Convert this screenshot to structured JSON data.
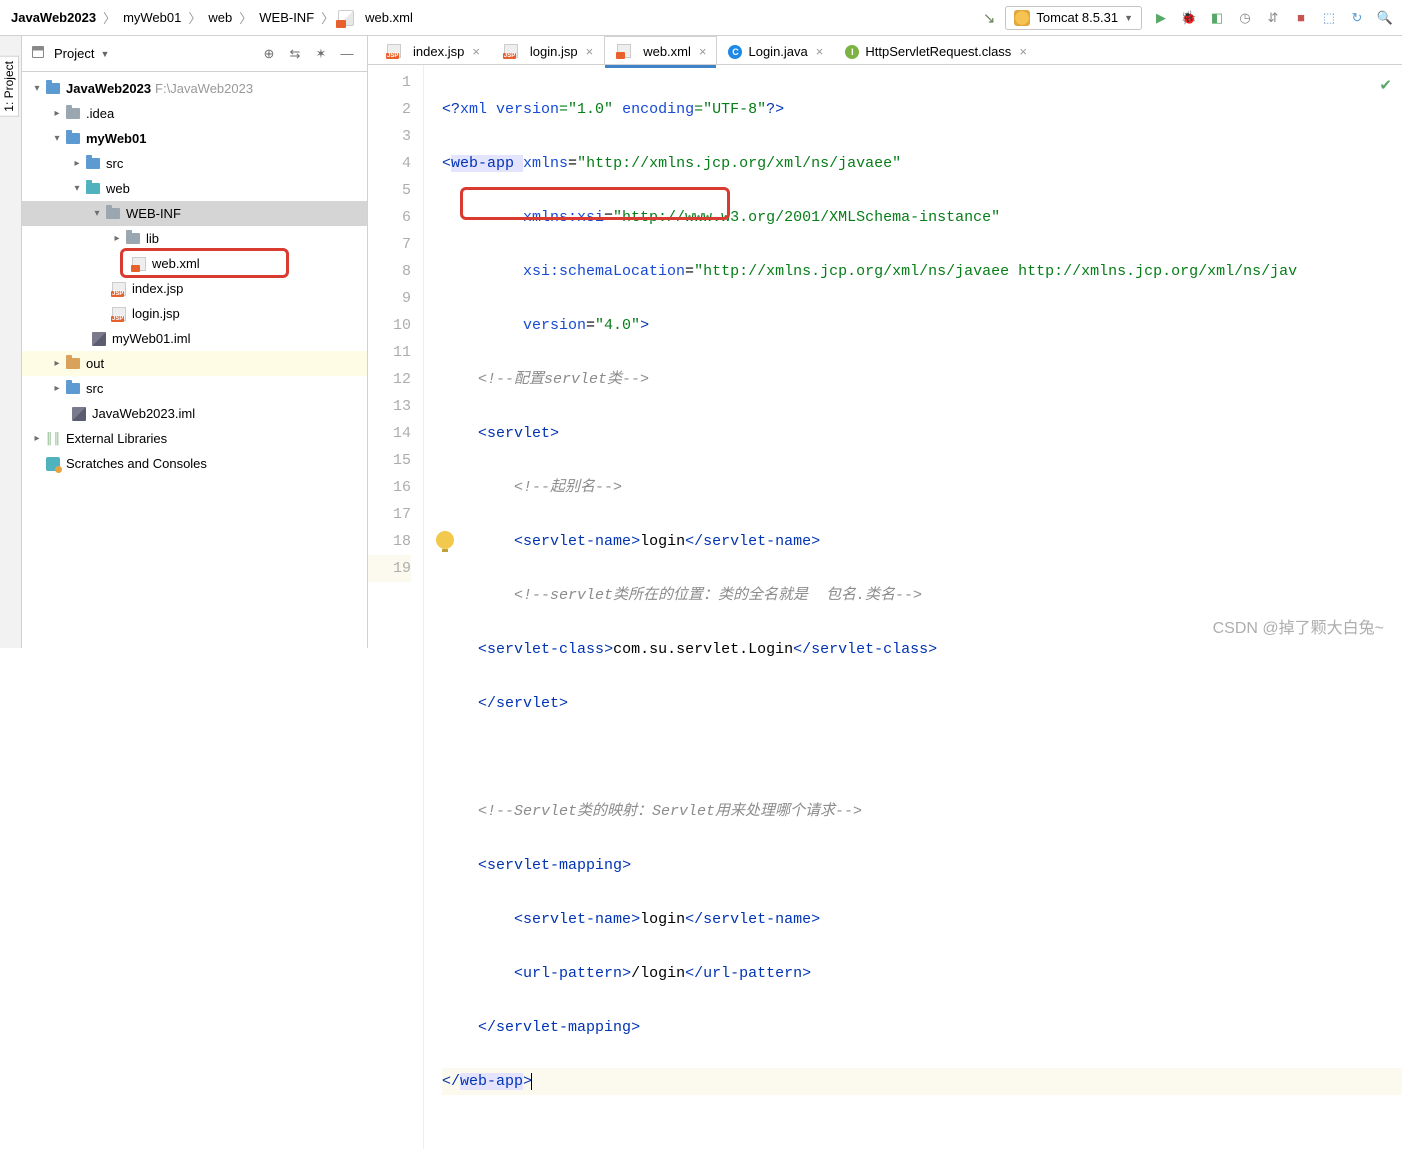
{
  "breadcrumb": {
    "p1": "JavaWeb2023",
    "p2": "myWeb01",
    "p3": "web",
    "p4": "WEB-INF",
    "p5": "web.xml"
  },
  "runConfig": {
    "label": "Tomcat 8.5.31"
  },
  "projectPanel": {
    "title": "Project"
  },
  "tree": {
    "root": {
      "name": "JavaWeb2023",
      "path": "F:\\JavaWeb2023"
    },
    "idea": ".idea",
    "myweb": "myWeb01",
    "src1": "src",
    "web": "web",
    "webinf": "WEB-INF",
    "lib": "lib",
    "webxml": "web.xml",
    "indexjsp": "index.jsp",
    "loginjsp": "login.jsp",
    "myweb_iml": "myWeb01.iml",
    "out": "out",
    "src2": "src",
    "jw_iml": "JavaWeb2023.iml",
    "extlib": "External Libraries",
    "scratch": "Scratches and Consoles"
  },
  "tabs": {
    "t1": "index.jsp",
    "t2": "login.jsp",
    "t3": "web.xml",
    "t4": "Login.java",
    "t5": "HttpServletRequest.class"
  },
  "leftTab": "1: Project",
  "code": {
    "l1a": "<?",
    "l1b": "xml version",
    "l1c": "=\"1.0\" ",
    "l1d": "encoding",
    "l1e": "=\"UTF-8\"",
    "l1f": "?>",
    "l2a": "<",
    "l2b": "web-app ",
    "l2c": "xmlns",
    "l2d": "=",
    "l2e": "\"http://xmlns.jcp.org/xml/ns/javaee\"",
    "l3a": "xmlns:xsi",
    "l3b": "=",
    "l3c": "\"http://www.w3.org/2001/XMLSchema-instance\"",
    "l4a": "xsi:schemaLocation",
    "l4b": "=",
    "l4c": "\"http://xmlns.jcp.org/xml/ns/javaee http://xmlns.jcp.org/xml/ns/jav",
    "l5a": "version",
    "l5b": "=",
    "l5c": "\"4.0\"",
    "l5d": ">",
    "l6": "<!--配置servlet类-->",
    "l7a": "<",
    "l7b": "servlet",
    "l7c": ">",
    "l8": "<!--起别名-->",
    "l9a": "<",
    "l9b": "servlet-name",
    "l9c": ">",
    "l9d": "login",
    "l9e": "</",
    "l9f": "servlet-name",
    "l9g": ">",
    "l10": "<!--servlet类所在的位置：类的全名就是  包名.类名-->",
    "l11a": "<",
    "l11b": "servlet-class",
    "l11c": ">",
    "l11d": "com.su.servlet.Login",
    "l11e": "</",
    "l11f": "servlet-class",
    "l11g": ">",
    "l12a": "</",
    "l12b": "servlet",
    "l12c": ">",
    "l14": "<!--Servlet类的映射：Servlet用来处理哪个请求-->",
    "l15a": "<",
    "l15b": "servlet-mapping",
    "l15c": ">",
    "l16a": "<",
    "l16b": "servlet-name",
    "l16c": ">",
    "l16d": "login",
    "l16e": "</",
    "l16f": "servlet-name",
    "l16g": ">",
    "l17a": "<",
    "l17b": "url-pattern",
    "l17c": ">",
    "l17d": "/login",
    "l17e": "</",
    "l17f": "url-pattern",
    "l17g": ">",
    "l18a": "</",
    "l18b": "servlet-mapping",
    "l18c": ">",
    "l19a": "</",
    "l19b": "web-app",
    "l19c": ">"
  },
  "lineNums": [
    "1",
    "2",
    "3",
    "4",
    "5",
    "6",
    "7",
    "8",
    "9",
    "10",
    "11",
    "12",
    "13",
    "14",
    "15",
    "16",
    "17",
    "18",
    "19"
  ],
  "watermark": "CSDN @掉了颗大白兔~"
}
